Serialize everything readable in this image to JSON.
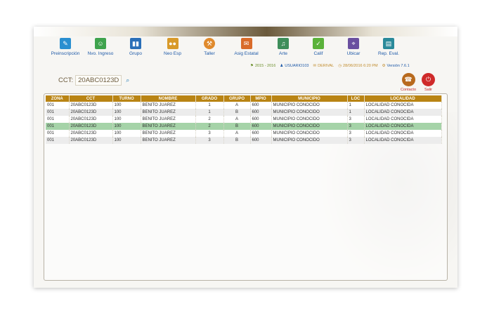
{
  "toolbar": {
    "items": [
      {
        "label": "Preinscripción",
        "icon": "preinscription-icon",
        "color": "#2a8fd0"
      },
      {
        "label": "Nvo. Ingreso",
        "icon": "new-student-icon",
        "color": "#3fa34d"
      },
      {
        "label": "Grupo",
        "icon": "group-icon",
        "color": "#2a6fb8"
      },
      {
        "label": "Neo Esp",
        "icon": "special-needs-icon",
        "color": "#d89a2a"
      },
      {
        "label": "Taller",
        "icon": "workshop-icon",
        "color": "#e08a2c"
      },
      {
        "label": "Asig Estatal",
        "icon": "state-subject-icon",
        "color": "#d96b2a"
      },
      {
        "label": "Arte",
        "icon": "art-icon",
        "color": "#3e8e5a"
      },
      {
        "label": "Calif",
        "icon": "grades-icon",
        "color": "#5bb23a"
      },
      {
        "label": "Ubicar",
        "icon": "locate-icon",
        "color": "#6a4fa0"
      },
      {
        "label": "Rep. Eval.",
        "icon": "report-icon",
        "color": "#2a8a9a"
      }
    ]
  },
  "status": {
    "period": "2015 - 2016",
    "user": "USUARIO103",
    "office": "DERIVAL",
    "datetime": "28/06/2016 6:20 PM",
    "version": "Versión 7.6.1"
  },
  "cct": {
    "label": "CCT:",
    "value": "20ABC0123D"
  },
  "actions": {
    "contact": "Contacto",
    "exit": "Salir"
  },
  "table": {
    "headers": [
      "ZONA",
      "CCT",
      "TURNO",
      "NOMBRE",
      "GRADO",
      "GRUPO",
      "MPIO",
      "MUNICIPIO",
      "LOC",
      "LOCALIDAD"
    ],
    "rows": [
      [
        "001",
        "20ABC0123D",
        "100",
        "BENITO JUAREZ",
        "1",
        "A",
        "600",
        "MUNICIPIO CONOCIDO",
        "1",
        "LOCALIDAD CONOCIDA"
      ],
      [
        "001",
        "20ABC0123D",
        "100",
        "BENITO JUAREZ",
        "1",
        "B",
        "600",
        "MUNICIPIO CONOCIDO",
        "1",
        "LOCALIDAD CONOCIDA"
      ],
      [
        "001",
        "20ABC0123D",
        "100",
        "BENITO JUAREZ",
        "2",
        "A",
        "600",
        "MUNICIPIO CONOCIDO",
        "3",
        "LOCALIDAD CONOCIDA"
      ],
      [
        "001",
        "20ABC0123D",
        "100",
        "BENITO JUAREZ",
        "2",
        "B",
        "600",
        "MUNICIPIO CONOCIDO",
        "3",
        "LOCALIDAD CONOCIDA"
      ],
      [
        "001",
        "20ABC0123D",
        "100",
        "BENITO JUAREZ",
        "3",
        "A",
        "600",
        "MUNICIPIO CONOCIDO",
        "3",
        "LOCALIDAD CONOCIDA"
      ],
      [
        "001",
        "20ABC0123D",
        "100",
        "BENITO JUAREZ",
        "3",
        "B",
        "600",
        "MUNICIPIO CONOCIDO",
        "3",
        "LOCALIDAD CONOCIDA"
      ]
    ],
    "selected_row": 3
  },
  "colors": {
    "header": "#b98414",
    "selected": "#a5d3a8",
    "link": "#1f5aa8",
    "contact": "#b86a1e",
    "exit": "#cf2a2a"
  }
}
